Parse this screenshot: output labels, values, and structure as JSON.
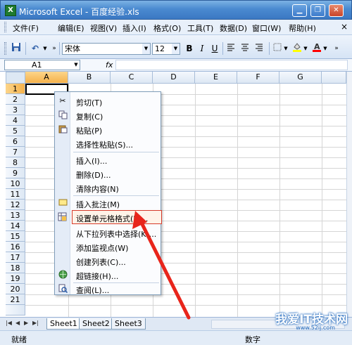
{
  "window": {
    "title": "Microsoft Excel - 百度经验.xls",
    "app_icon": "excel-icon",
    "controls": [
      "minimize-icon",
      "restore-icon",
      "close-icon"
    ]
  },
  "menubar": {
    "items": [
      "文件(F)",
      "编辑(E)",
      "视图(V)",
      "插入(I)",
      "格式(O)",
      "工具(T)",
      "数据(D)",
      "窗口(W)",
      "帮助(H)"
    ],
    "close_glyph": "×"
  },
  "toolbar": {
    "save_icon": "save-icon",
    "undo_icon": "undo-icon",
    "font_name": "宋体",
    "font_size": "12",
    "bold": "B",
    "italic": "I",
    "underline": "U",
    "fill_color": "#ffff00",
    "font_color": "#ff0000"
  },
  "formula_bar": {
    "name_box": "A1",
    "fx": "fx",
    "value": ""
  },
  "grid": {
    "columns": [
      "A",
      "B",
      "C",
      "D",
      "E",
      "F",
      "G"
    ],
    "rows": [
      "1",
      "2",
      "3",
      "4",
      "5",
      "6",
      "7",
      "8",
      "9",
      "10",
      "11",
      "12",
      "13",
      "14",
      "15",
      "16",
      "17",
      "18",
      "19",
      "20",
      "21"
    ],
    "active_cell": "A1"
  },
  "context_menu": {
    "items": [
      {
        "label": "剪切(T)",
        "icon": "cut-icon"
      },
      {
        "label": "复制(C)",
        "icon": "copy-icon"
      },
      {
        "label": "粘贴(P)",
        "icon": "paste-icon"
      },
      {
        "label": "选择性粘贴(S)...",
        "icon": ""
      },
      {
        "label": "插入(I)...",
        "icon": ""
      },
      {
        "label": "删除(D)...",
        "icon": ""
      },
      {
        "label": "清除内容(N)",
        "icon": ""
      },
      {
        "label": "插入批注(M)",
        "icon": "comment-icon"
      },
      {
        "label": "设置单元格格式(F)...",
        "icon": "format-cells-icon",
        "highlighted": true
      },
      {
        "label": "从下拉列表中选择(K)...",
        "icon": ""
      },
      {
        "label": "添加监视点(W)",
        "icon": ""
      },
      {
        "label": "创建列表(C)...",
        "icon": ""
      },
      {
        "label": "超链接(H)...",
        "icon": "hyperlink-icon"
      },
      {
        "label": "查阅(L)...",
        "icon": "lookup-icon"
      }
    ]
  },
  "sheet_tabs": {
    "tabs": [
      "Sheet1",
      "Sheet2",
      "Sheet3"
    ],
    "active": "Sheet1"
  },
  "status_bar": {
    "ready": "就绪",
    "mode": "数字"
  },
  "annotation": {
    "arrow_color": "#e8251b"
  },
  "watermark": {
    "text": "我爱IT技术网",
    "url": "www.52ij.com"
  }
}
